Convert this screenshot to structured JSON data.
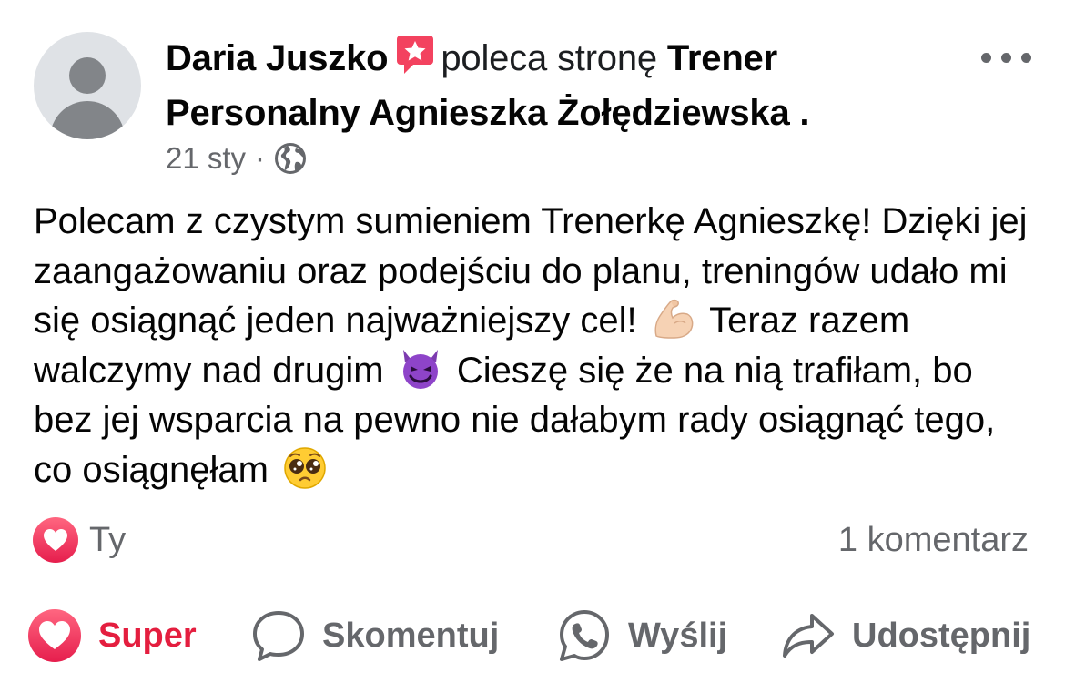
{
  "post": {
    "author": "Daria Juszko",
    "verb": "poleca stronę",
    "page_name": "Trener Personalny Agnieszka Żołędziewska",
    "page_name_suffix": " .",
    "date": "21 sty",
    "separator": "·",
    "audience_icon": "globe-icon",
    "body": {
      "t1": "Polecam z czystym sumieniem Trenerkę Agnieszkę! Dzięki jej zaangażowaniu oraz podejściu do planu, treningów udało mi się osiągnąć jeden najważniejszy cel!",
      "e1": "flexed-biceps-emoji",
      "t2": "Teraz razem walczymy nad drugim",
      "e2": "smiling-devil-emoji",
      "t3": "Cieszę się że na nią trafiłam, bo bez jej wsparcia na pewno nie dałabym rady osiągnąć tego, co osiągnęłam",
      "e3": "pleading-face-emoji"
    }
  },
  "reactions": {
    "icon": "love-reaction-icon",
    "names": "Ty",
    "comments_count": "1 komentarz"
  },
  "actions": {
    "like_label": "Super",
    "comment_label": "Skomentuj",
    "send_label": "Wyślij",
    "share_label": "Udostępnij"
  },
  "colors": {
    "like_active": "#e41e3f",
    "secondary_text": "#65676b",
    "recommend_badge": "#f3425f"
  }
}
